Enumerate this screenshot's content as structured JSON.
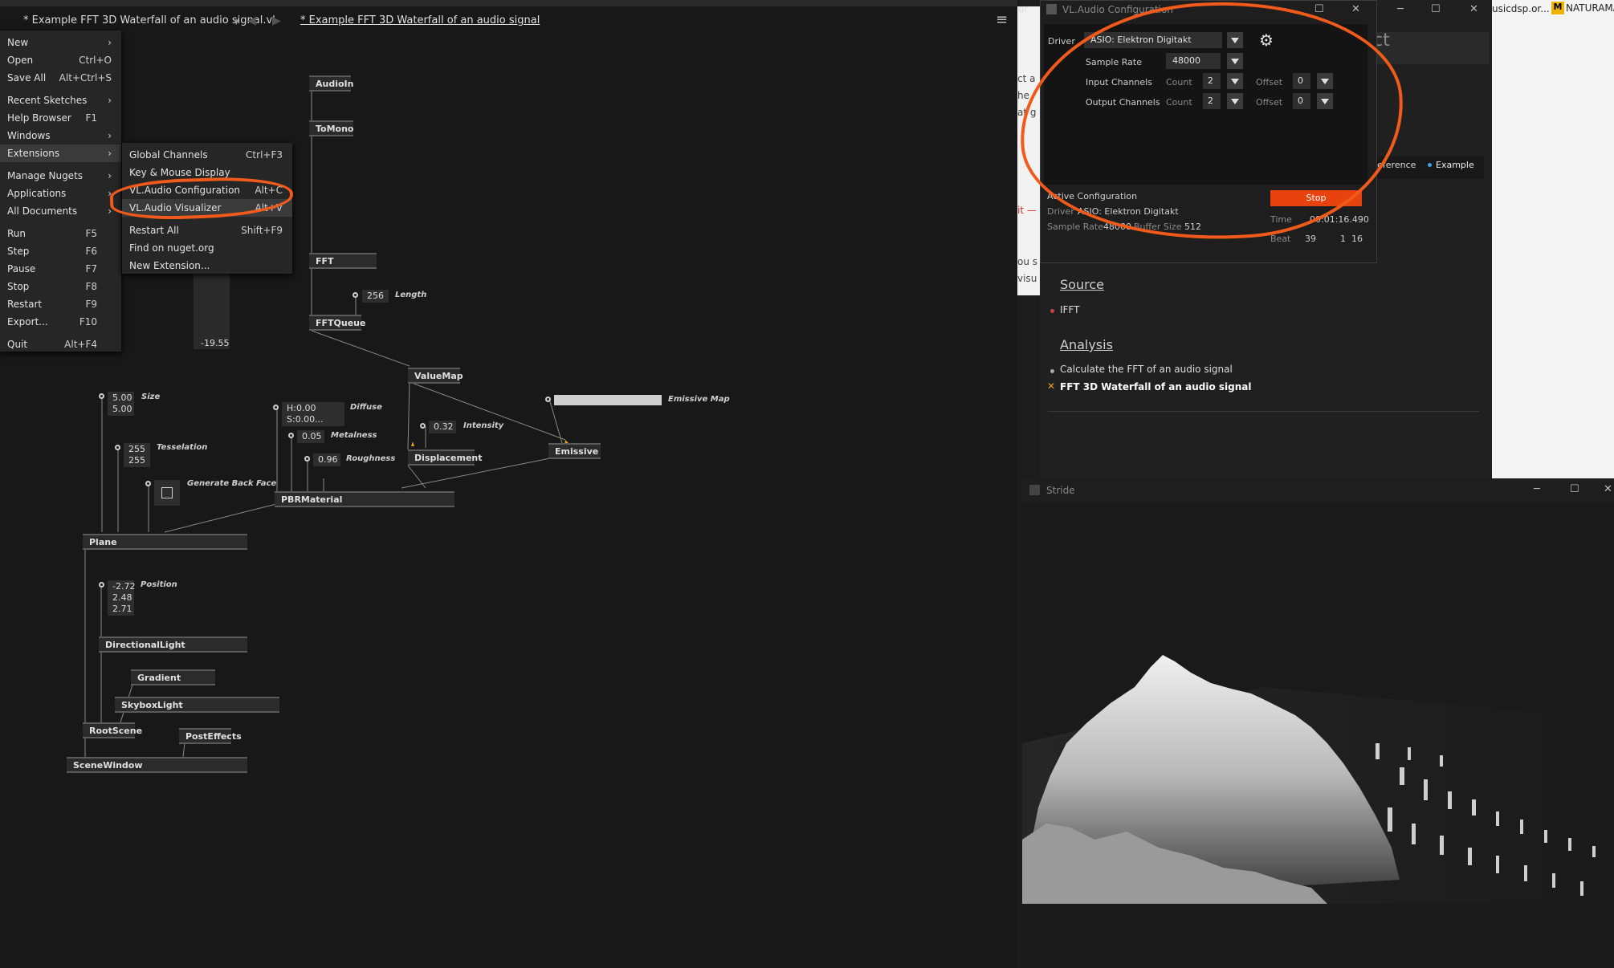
{
  "editor": {
    "tab_title": "* Example FFT 3D Waterfall of an audio signal.vl",
    "doc_title": "* Example FFT 3D Waterfall of an audio signal"
  },
  "main_menu": [
    {
      "label": "New",
      "shortcut": ""
    },
    {
      "label": "Open",
      "shortcut": "Ctrl+O"
    },
    {
      "label": "Save All",
      "shortcut": "Alt+Ctrl+S"
    },
    {
      "label": "Recent Sketches",
      "shortcut": ""
    },
    {
      "label": "Help Browser",
      "shortcut": "F1"
    },
    {
      "label": "Windows",
      "shortcut": ""
    },
    {
      "label": "Extensions",
      "shortcut": ""
    },
    {
      "label": "Manage Nugets",
      "shortcut": ""
    },
    {
      "label": "Applications",
      "shortcut": ""
    },
    {
      "label": "All Documents",
      "shortcut": ""
    },
    {
      "label": "Run",
      "shortcut": "F5"
    },
    {
      "label": "Step",
      "shortcut": "F6"
    },
    {
      "label": "Pause",
      "shortcut": "F7"
    },
    {
      "label": "Stop",
      "shortcut": "F8"
    },
    {
      "label": "Restart",
      "shortcut": "F9"
    },
    {
      "label": "Export...",
      "shortcut": "F10"
    },
    {
      "label": "Quit",
      "shortcut": "Alt+F4"
    }
  ],
  "ext_menu": [
    {
      "label": "Global Channels",
      "shortcut": "Ctrl+F3"
    },
    {
      "label": "Key & Mouse Display",
      "shortcut": ""
    },
    {
      "label": "VL.Audio Configuration",
      "shortcut": "Alt+C"
    },
    {
      "label": "VL.Audio Visualizer",
      "shortcut": "Alt+V"
    },
    {
      "label": "Restart All",
      "shortcut": "Shift+F9"
    },
    {
      "label": "Find on nuget.org",
      "shortcut": ""
    },
    {
      "label": "New Extension...",
      "shortcut": ""
    }
  ],
  "nodes": {
    "audioin": "AudioIn",
    "tomono": "ToMono",
    "fft": "FFT",
    "fftqueue": "FFTQueue",
    "valuemap": "ValueMap",
    "displacement": "Displacement",
    "emissive": "Emissive",
    "pbrmaterial": "PBRMaterial",
    "plane": "Plane",
    "directionallight": "DirectionalLight",
    "gradient": "Gradient",
    "skyboxlight": "SkyboxLight",
    "rootscene": "RootScene",
    "posteffects": "PostEffects",
    "scenewindow": "SceneWindow"
  },
  "values": {
    "readout": "-19.55",
    "length": "256",
    "length_label": "Length",
    "size1": "5.00",
    "size2": "5.00",
    "size_label": "Size",
    "tess1": "255",
    "tess2": "255",
    "tess_label": "Tesselation",
    "backface_label": "Generate Back Face",
    "diffuse": "H:0.00 S:0.00...",
    "diffuse_label": "Diffuse",
    "metal": "0.05",
    "metal_label": "Metalness",
    "rough": "0.96",
    "rough_label": "Roughness",
    "intensity": "0.32",
    "intensity_label": "Intensity",
    "emissive_label": "Emissive Map",
    "pos1": "-2.72",
    "pos2": "2.48",
    "pos3": "2.71",
    "pos_label": "Position"
  },
  "config": {
    "window_title": "VL.Audio Configuration",
    "driver_label": "Driver",
    "driver_value": "ASIO: Elektron Digitakt",
    "sample_rate_label": "Sample Rate",
    "sample_rate_value": "48000",
    "input_label": "Input Channels",
    "output_label": "Output Channels",
    "count_label": "Count",
    "offset_label": "Offset",
    "in_count": "2",
    "in_offset": "0",
    "out_count": "2",
    "out_offset": "0",
    "active_label": "Active Configuration",
    "active_driver_label": "Driver",
    "active_driver": "ASIO: Elektron Digitakt",
    "active_sr_label": "Sample Rate",
    "active_sr": "48000",
    "buffer_label": "Buffer Size",
    "buffer": "512",
    "stop_label": "Stop",
    "time_label": "Time",
    "time": "00:01:16.490",
    "beat_label": "Beat",
    "beat1": "39",
    "beat2": "1",
    "beat3": "16"
  },
  "doc": {
    "title_fragment": "ct",
    "left_fragments": [
      "ct a",
      "he",
      "at g",
      "it —",
      "ou s",
      "visu"
    ],
    "reference": "Reference",
    "example": "Example",
    "source_heading": "Source",
    "source_item": "IFFT",
    "analysis_heading": "Analysis",
    "analysis_item1": "Calculate the FFT of an audio signal",
    "analysis_item2": "FFT 3D Waterfall of an audio signal"
  },
  "stride": {
    "title": "Stride"
  },
  "background_windows": {
    "left_fragment": "or",
    "site_fragment": "usicdsp.or...",
    "natura": "NATURAMA"
  },
  "colors": {
    "accent": "#f05a1a",
    "stop_button": "#e8430f",
    "bullet_blue": "#3aa5e0",
    "bullet_orange": "#e8a020"
  }
}
